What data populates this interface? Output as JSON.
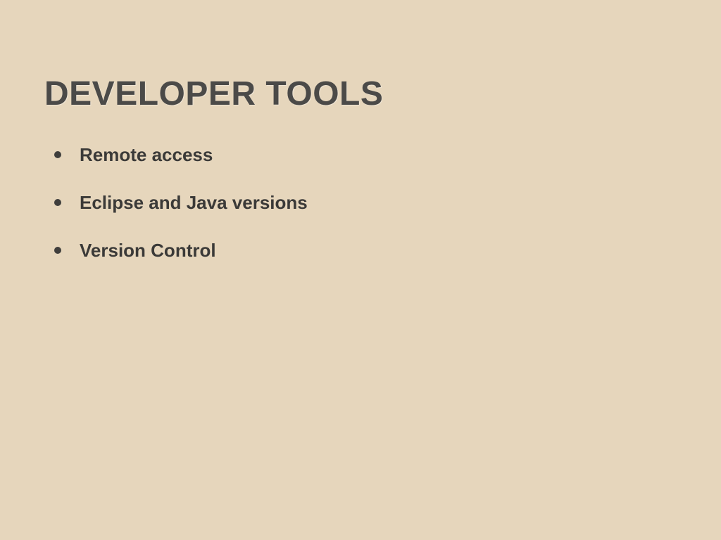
{
  "slide": {
    "title": "DEVELOPER TOOLS",
    "bullets": [
      "Remote access",
      "Eclipse and Java versions",
      "Version Control"
    ]
  },
  "colors": {
    "background": "#e6d6bc",
    "title": "#4b4a48",
    "text": "#3b3a38"
  }
}
